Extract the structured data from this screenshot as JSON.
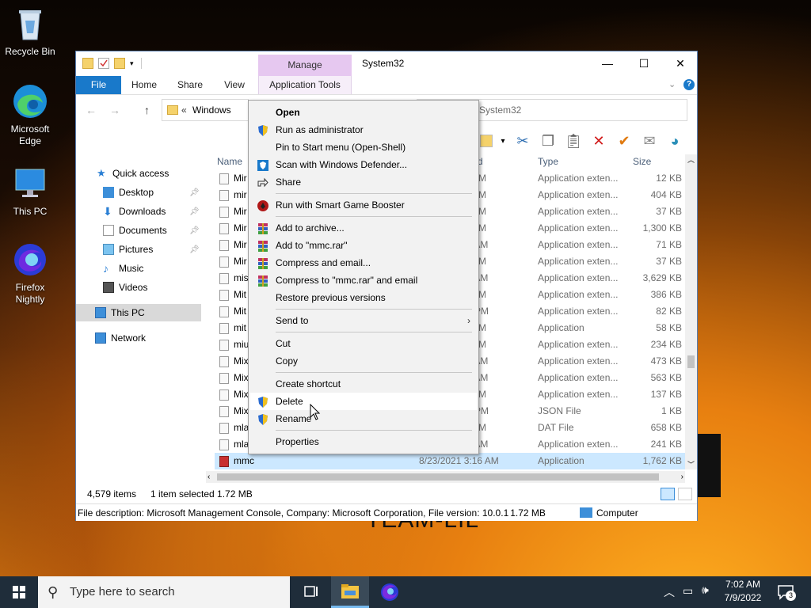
{
  "desktop": {
    "icons": [
      {
        "label": "Recycle Bin"
      },
      {
        "label": "Microsoft Edge"
      },
      {
        "label": "This PC"
      },
      {
        "label": "Firefox Nightly"
      }
    ],
    "wallpaper_text": "TEAM-LIL"
  },
  "window": {
    "title": "System32",
    "manage_tab": "Manage",
    "ribbon_tabs": [
      "File",
      "Home",
      "Share",
      "View",
      "Application Tools"
    ],
    "address": {
      "prefix": "«",
      "crumb": "Windows"
    },
    "search_placeholder": "System32",
    "nav": {
      "quick_access": "Quick access",
      "items": [
        "Desktop",
        "Downloads",
        "Documents",
        "Pictures",
        "Music",
        "Videos"
      ],
      "this_pc": "This PC",
      "network": "Network"
    },
    "columns": {
      "name": "Name",
      "date": "d",
      "type": "Type",
      "size": "Size"
    },
    "rows": [
      {
        "name": "Mir",
        "date": "PM",
        "type": "Application exten...",
        "size": "12 KB"
      },
      {
        "name": "mir",
        "date": "PM",
        "type": "Application exten...",
        "size": "404 KB"
      },
      {
        "name": "Mir",
        "date": "AM",
        "type": "Application exten...",
        "size": "37 KB"
      },
      {
        "name": "Mir",
        "date": "AM",
        "type": "Application exten...",
        "size": "1,300 KB"
      },
      {
        "name": "Mir",
        "date": "5 AM",
        "type": "Application exten...",
        "size": "71 KB"
      },
      {
        "name": "Mir",
        "date": "PM",
        "type": "Application exten...",
        "size": "37 KB"
      },
      {
        "name": "mis",
        "date": "5 AM",
        "type": "Application exten...",
        "size": "3,629 KB"
      },
      {
        "name": "Mit",
        "date": "AM",
        "type": "Application exten...",
        "size": "386 KB"
      },
      {
        "name": "Mit",
        "date": "5 PM",
        "type": "Application exten...",
        "size": "82 KB"
      },
      {
        "name": "mit",
        "date": "PM",
        "type": "Application",
        "size": "58 KB"
      },
      {
        "name": "miu",
        "date": "PM",
        "type": "Application exten...",
        "size": "234 KB"
      },
      {
        "name": "Mix",
        "date": "5 AM",
        "type": "Application exten...",
        "size": "473 KB"
      },
      {
        "name": "Mix",
        "date": "5 AM",
        "type": "Application exten...",
        "size": "563 KB"
      },
      {
        "name": "Mix",
        "date": "AM",
        "type": "Application exten...",
        "size": "137 KB"
      },
      {
        "name": "Mix",
        "date": "5 PM",
        "type": "JSON File",
        "size": "1 KB"
      },
      {
        "name": "mla",
        "date": "PM",
        "type": "DAT File",
        "size": "658 KB"
      },
      {
        "name": "mla",
        "date": "5 AM",
        "type": "Application exten...",
        "size": "241 KB"
      },
      {
        "name": "mmc",
        "date": "8/23/2021 3:16 AM",
        "type": "Application",
        "size": "1,762 KB"
      }
    ],
    "status": {
      "items": "4,579 items",
      "selected": "1 item selected  1.72 MB"
    },
    "details": {
      "description": "File description: Microsoft Management Console, Company: Microsoft Corporation, File version: 10.0.1 1.72 MB",
      "location": "Computer"
    }
  },
  "context_menu": {
    "items": [
      {
        "label": "Open",
        "bold": true
      },
      {
        "label": "Run as administrator"
      },
      {
        "label": "Pin to Start menu (Open-Shell)"
      },
      {
        "label": "Scan with Windows Defender..."
      },
      {
        "label": "Share"
      },
      {
        "label": "Run with Smart Game Booster"
      },
      {
        "label": "Add to archive..."
      },
      {
        "label": "Add to \"mmc.rar\""
      },
      {
        "label": "Compress and email..."
      },
      {
        "label": "Compress to \"mmc.rar\" and email"
      },
      {
        "label": "Restore previous versions"
      },
      {
        "label": "Send to"
      },
      {
        "label": "Cut"
      },
      {
        "label": "Copy"
      },
      {
        "label": "Create shortcut"
      },
      {
        "label": "Delete"
      },
      {
        "label": "Rename"
      },
      {
        "label": "Properties"
      }
    ]
  },
  "taskbar": {
    "search_placeholder": "Type here to search",
    "time": "7:02 AM",
    "date": "7/9/2022",
    "notification_count": "3"
  },
  "colors": {
    "accent": "#1979ca",
    "selection": "#cce8ff",
    "manage": "#e6c8f0"
  }
}
